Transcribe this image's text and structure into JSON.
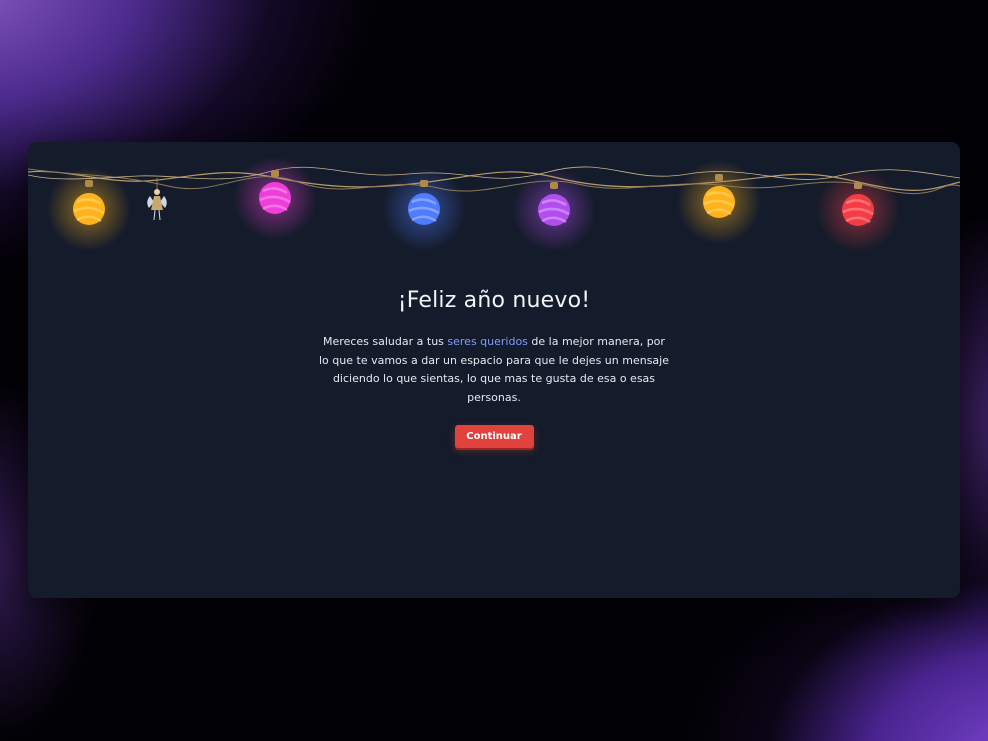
{
  "card": {
    "title": "¡Feliz año nuevo!",
    "message_start": "Mereces saludar a tus ",
    "message_highlight": "seres queridos",
    "message_end": " de la mejor manera, por lo que te vamos a dar un espacio para que le dejes un mensaje diciendo lo que sientas, lo que mas te gusta de esa o esas personas.",
    "button_label": "Continuar"
  },
  "colors": {
    "card_background": "#141b2a",
    "highlight": "#7f9cff",
    "button": "#e2423d"
  },
  "lights": {
    "ornament_colors": [
      "#ffb21c",
      "#ee3fd8",
      "#4f7bff",
      "#b24ef0",
      "#ffb21c",
      "#f33d45"
    ],
    "decoration": "angel-ornament-icon"
  }
}
